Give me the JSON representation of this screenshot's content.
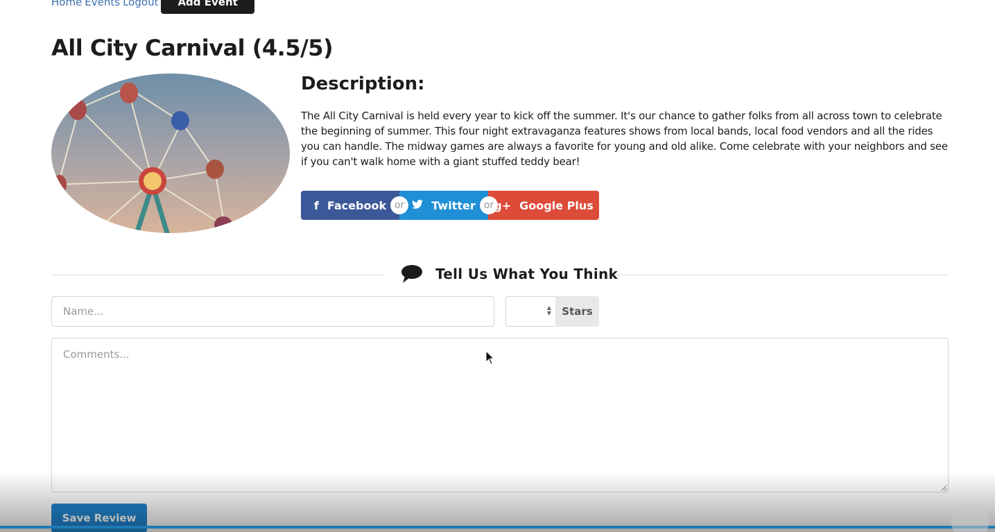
{
  "nav": {
    "links": [
      "Home",
      "Events",
      "Logout"
    ],
    "add_event": "Add Event"
  },
  "event": {
    "title": "All City Carnival (4.5/5)",
    "image_alt": "Ferris wheel",
    "description_heading": "Description:",
    "description": "The All City Carnival is held every year to kick off the summer. It's our chance to gather folks from all across town to celebrate the beginning of summer. This four night extravaganza features shows from local bands, local food vendors and all the rides you can handle. The midway games are always a favorite for young and old alike. Come celebrate with your neighbors and see if you can't walk home with a giant stuffed teddy bear!"
  },
  "share": {
    "facebook": "Facebook",
    "twitter": "Twitter",
    "google": "Google Plus",
    "or": "or",
    "colors": {
      "facebook": "#3b5998",
      "twitter": "#1f8fd6",
      "google": "#dd4b39"
    }
  },
  "review": {
    "heading": "Tell Us What You Think",
    "name_placeholder": "Name...",
    "stars_label": "Stars",
    "comments_placeholder": "Comments...",
    "save_label": "Save Review"
  }
}
